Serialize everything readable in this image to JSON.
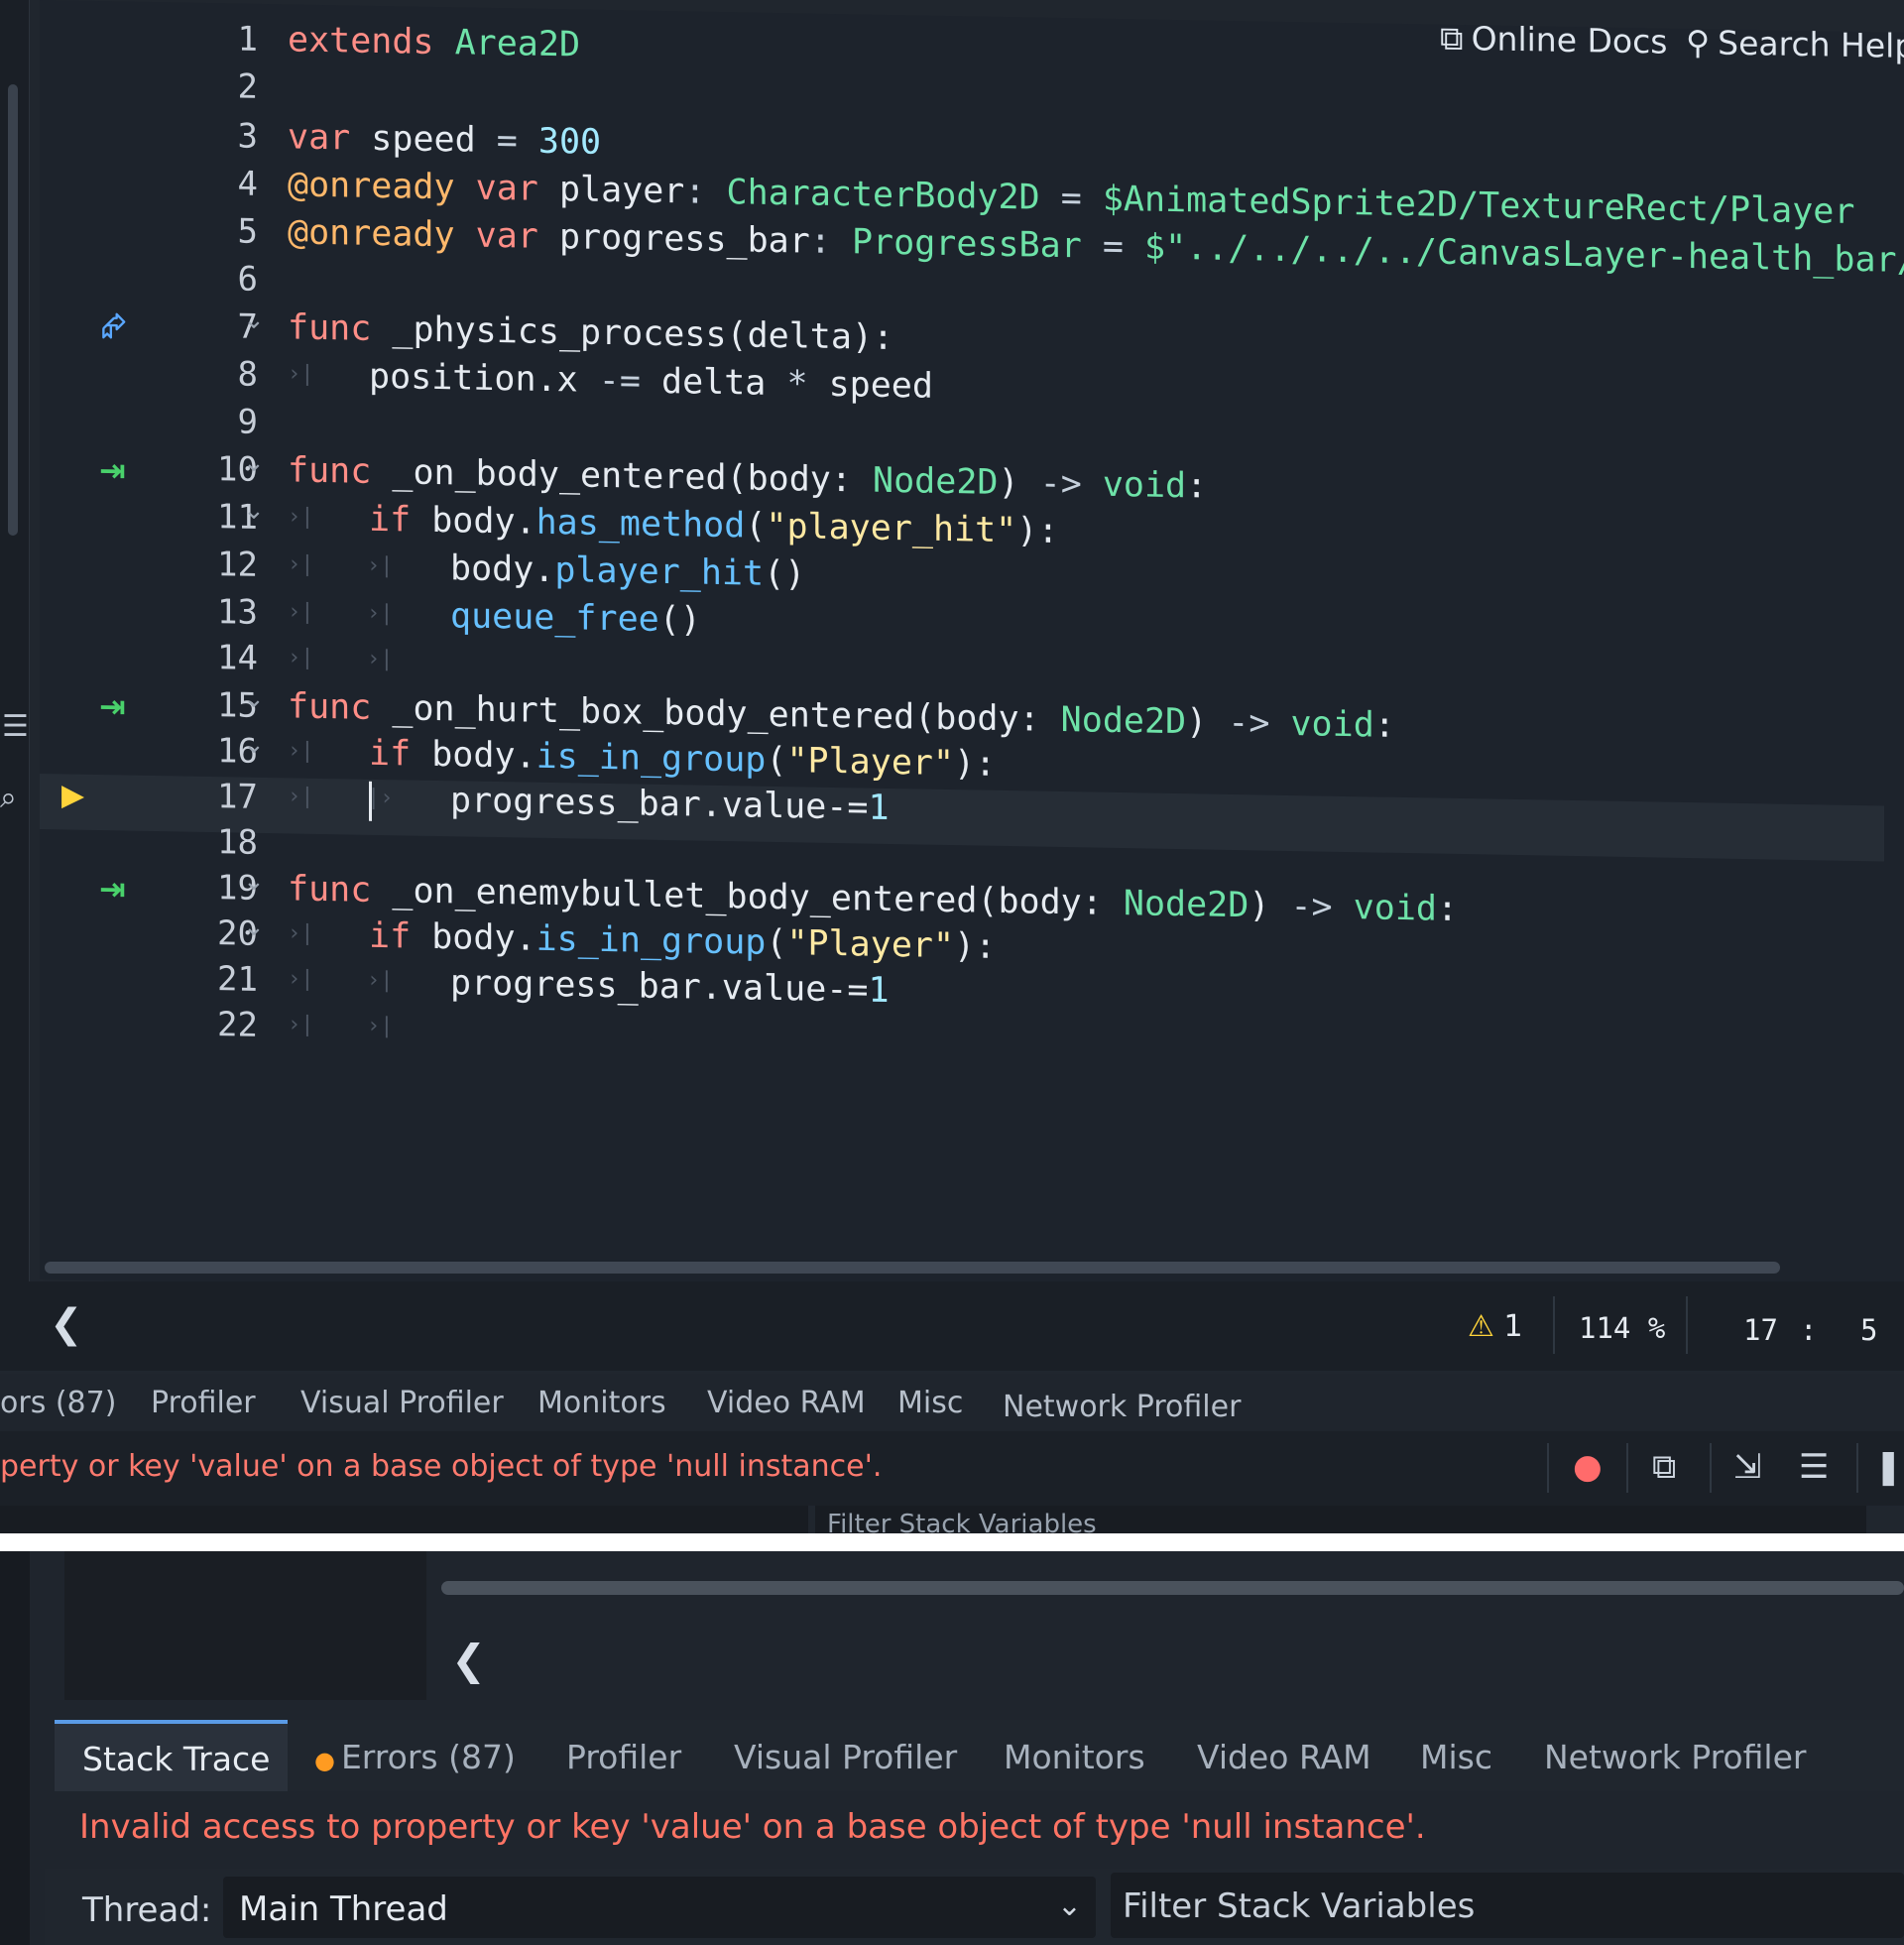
{
  "help": {
    "online_docs": "Online Docs",
    "search_help": "Search Help"
  },
  "code_lines": [
    {
      "n": "1",
      "tokens": [
        [
          "k",
          "extends"
        ],
        [
          "sym",
          " "
        ],
        [
          "ty",
          "Area2D"
        ]
      ]
    },
    {
      "n": "2",
      "tokens": []
    },
    {
      "n": "3",
      "tokens": [
        [
          "k",
          "var"
        ],
        [
          "sym",
          " "
        ],
        [
          "kv",
          "speed"
        ],
        [
          "sym",
          " = "
        ],
        [
          "num",
          "300"
        ]
      ]
    },
    {
      "n": "4",
      "tokens": [
        [
          "at",
          "@onready"
        ],
        [
          "sym",
          " "
        ],
        [
          "k",
          "var"
        ],
        [
          "sym",
          " "
        ],
        [
          "kv",
          "player"
        ],
        [
          "sym",
          ": "
        ],
        [
          "ty",
          "CharacterBody2D"
        ],
        [
          "sym",
          " = "
        ],
        [
          "np",
          "$AnimatedSprite2D/TextureRect/Player"
        ]
      ]
    },
    {
      "n": "5",
      "tokens": [
        [
          "at",
          "@onready"
        ],
        [
          "sym",
          " "
        ],
        [
          "k",
          "var"
        ],
        [
          "sym",
          " "
        ],
        [
          "kv",
          "progress_bar"
        ],
        [
          "sym",
          ": "
        ],
        [
          "ty",
          "ProgressBar"
        ],
        [
          "sym",
          " = "
        ],
        [
          "np",
          "$\"../../../../CanvasLayer-health_bar/"
        ]
      ]
    },
    {
      "n": "6",
      "tokens": []
    },
    {
      "n": "7",
      "tokens": [
        [
          "k",
          "func"
        ],
        [
          "sym",
          " "
        ],
        [
          "kv",
          "_physics_process(delta):"
        ]
      ]
    },
    {
      "n": "8",
      "tokens": [
        [
          "kv",
          "position.x"
        ],
        [
          "sym",
          " -= "
        ],
        [
          "kv",
          "delta"
        ],
        [
          "sym",
          " * "
        ],
        [
          "kv",
          "speed"
        ]
      ]
    },
    {
      "n": "9",
      "tokens": []
    },
    {
      "n": "10",
      "tokens": [
        [
          "k",
          "func"
        ],
        [
          "sym",
          " "
        ],
        [
          "kv",
          "_on_body_entered(body: "
        ],
        [
          "ty",
          "Node2D"
        ],
        [
          "kv",
          ")"
        ],
        [
          "sym",
          " -> "
        ],
        [
          "ty",
          "void"
        ],
        [
          "kv",
          ":"
        ]
      ]
    },
    {
      "n": "11",
      "tokens": [
        [
          "k",
          "if"
        ],
        [
          "sym",
          " "
        ],
        [
          "kv",
          "body."
        ],
        [
          "fn",
          "has_method"
        ],
        [
          "kv",
          "("
        ],
        [
          "str",
          "\"player_hit\""
        ],
        [
          "kv",
          "):"
        ]
      ]
    },
    {
      "n": "12",
      "tokens": [
        [
          "kv",
          "body."
        ],
        [
          "fn",
          "player_hit"
        ],
        [
          "kv",
          "()"
        ]
      ]
    },
    {
      "n": "13",
      "tokens": [
        [
          "fn",
          "queue_free"
        ],
        [
          "kv",
          "()"
        ]
      ]
    },
    {
      "n": "14",
      "tokens": []
    },
    {
      "n": "15",
      "tokens": [
        [
          "k",
          "func"
        ],
        [
          "sym",
          " "
        ],
        [
          "kv",
          "_on_hurt_box_body_entered(body: "
        ],
        [
          "ty",
          "Node2D"
        ],
        [
          "kv",
          ")"
        ],
        [
          "sym",
          " -> "
        ],
        [
          "ty",
          "void"
        ],
        [
          "kv",
          ":"
        ]
      ]
    },
    {
      "n": "16",
      "tokens": [
        [
          "k",
          "if"
        ],
        [
          "sym",
          " "
        ],
        [
          "kv",
          "body."
        ],
        [
          "fn",
          "is_in_group"
        ],
        [
          "kv",
          "("
        ],
        [
          "str",
          "\"Player\""
        ],
        [
          "kv",
          "):"
        ]
      ]
    },
    {
      "n": "17",
      "tokens": [
        [
          "kv",
          "progress_bar.value-="
        ],
        [
          "num",
          "1"
        ]
      ]
    },
    {
      "n": "18",
      "tokens": []
    },
    {
      "n": "19",
      "tokens": [
        [
          "k",
          "func"
        ],
        [
          "sym",
          " "
        ],
        [
          "kv",
          "_on_enemybullet_body_entered(body: "
        ],
        [
          "ty",
          "Node2D"
        ],
        [
          "kv",
          ")"
        ],
        [
          "sym",
          " -> "
        ],
        [
          "ty",
          "void"
        ],
        [
          "kv",
          ":"
        ]
      ]
    },
    {
      "n": "20",
      "tokens": [
        [
          "k",
          "if"
        ],
        [
          "sym",
          " "
        ],
        [
          "kv",
          "body."
        ],
        [
          "fn",
          "is_in_group"
        ],
        [
          "kv",
          "("
        ],
        [
          "str",
          "\"Player\""
        ],
        [
          "kv",
          "):"
        ]
      ]
    },
    {
      "n": "21",
      "tokens": [
        [
          "kv",
          "progress_bar.value-="
        ],
        [
          "num",
          "1"
        ]
      ]
    },
    {
      "n": "22",
      "tokens": []
    }
  ],
  "status": {
    "warnings": "1",
    "zoom": "114 %",
    "line": "17",
    "col_sep": ":",
    "col": "5"
  },
  "tabs_partial": [
    "ors (87)",
    "Profiler",
    "Visual Profiler",
    "Monitors",
    "Video RAM",
    "Misc",
    "Network Profiler"
  ],
  "error_partial": "perty or key 'value' on a base object of type 'null instance'.",
  "filter_partial": "Filter Stack Variables",
  "tabs": [
    "Stack Trace",
    "Errors (87)",
    "Profiler",
    "Visual Profiler",
    "Monitors",
    "Video RAM",
    "Misc",
    "Network Profiler"
  ],
  "error_full": "Invalid access to property or key 'value' on a base object of type 'null instance'.",
  "thread_label": "Thread:",
  "thread_value": "Main Thread",
  "filter_stack": "Filter Stack Variables",
  "colors": {
    "keyword": "#ff8e87",
    "type": "#6ee2a8",
    "string": "#ffe9a3",
    "function": "#67c0ff",
    "error": "#ff7464",
    "accent": "#5a9be6"
  }
}
